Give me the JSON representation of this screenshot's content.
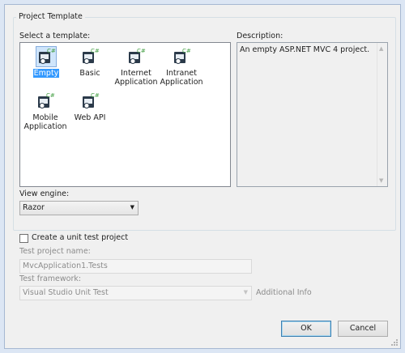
{
  "dialog": {
    "group_title": "Project Template",
    "select_template_label": "Select a template:",
    "templates": [
      {
        "label": "Empty",
        "selected": true
      },
      {
        "label": "Basic",
        "selected": false
      },
      {
        "label": "Internet Application",
        "selected": false
      },
      {
        "label": "Intranet Application",
        "selected": false
      },
      {
        "label": "Mobile Application",
        "selected": false
      },
      {
        "label": "Web API",
        "selected": false
      }
    ],
    "description_label": "Description:",
    "description_text": "An empty ASP.NET MVC 4 project.",
    "view_engine_label": "View engine:",
    "view_engine_value": "Razor",
    "unit_test_checkbox_label": "Create a unit test project",
    "unit_test_checked": false,
    "test_project_name_label": "Test project name:",
    "test_project_name_value": "MvcApplication1.Tests",
    "test_framework_label": "Test framework:",
    "test_framework_value": "Visual Studio Unit Test",
    "additional_info_label": "Additional Info",
    "ok_label": "OK",
    "cancel_label": "Cancel"
  },
  "colors": {
    "selection": "#3399ff",
    "window_bg": "#f0f0f0",
    "border": "#a6b8d2",
    "csharp_badge": "#46a046"
  },
  "icons": {
    "template": "web-project-csharp-icon"
  }
}
